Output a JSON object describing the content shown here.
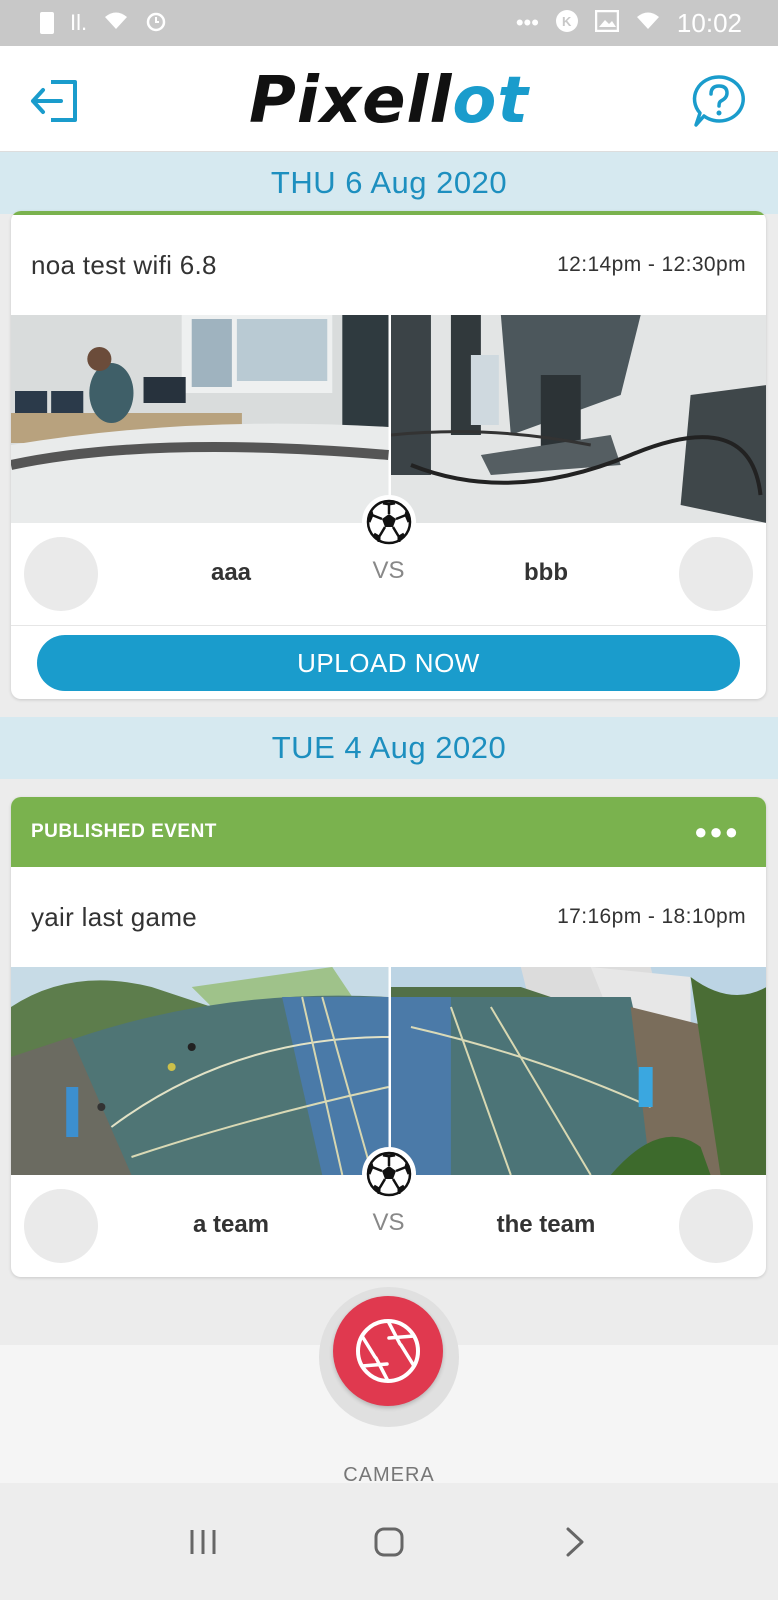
{
  "status_bar": {
    "time": "10:02",
    "left_icons": [
      "lock-icon",
      "signal-icon",
      "wifi-icon",
      "alarm-icon"
    ],
    "right_icons": [
      "more-icon",
      "k-icon",
      "image-icon",
      "wifi-icon"
    ]
  },
  "header": {
    "logo_prefix": "Pixell",
    "logo_accent": "ot",
    "logout_icon": "logout-icon",
    "help_icon": "help-icon"
  },
  "events": [
    {
      "date": "THU 6 Aug 2020",
      "title": "noa test wifi 6.8",
      "time": "12:14pm - 12:30pm",
      "team_home": "aaa",
      "team_away": "bbb",
      "vs": "VS",
      "action_label": "UPLOAD NOW"
    },
    {
      "date": "TUE 4 Aug 2020",
      "status": "PUBLISHED EVENT",
      "title": "yair last game",
      "time": "17:16pm - 18:10pm",
      "team_home": "a team",
      "team_away": "the team",
      "vs": "VS"
    }
  ],
  "bottom": {
    "camera_label": "CAMERA"
  },
  "colors": {
    "accent": "#1a9ccc",
    "published_green": "#7ab24e",
    "date_header_bg": "#d6e9f0",
    "camera_red": "#e0394f"
  }
}
